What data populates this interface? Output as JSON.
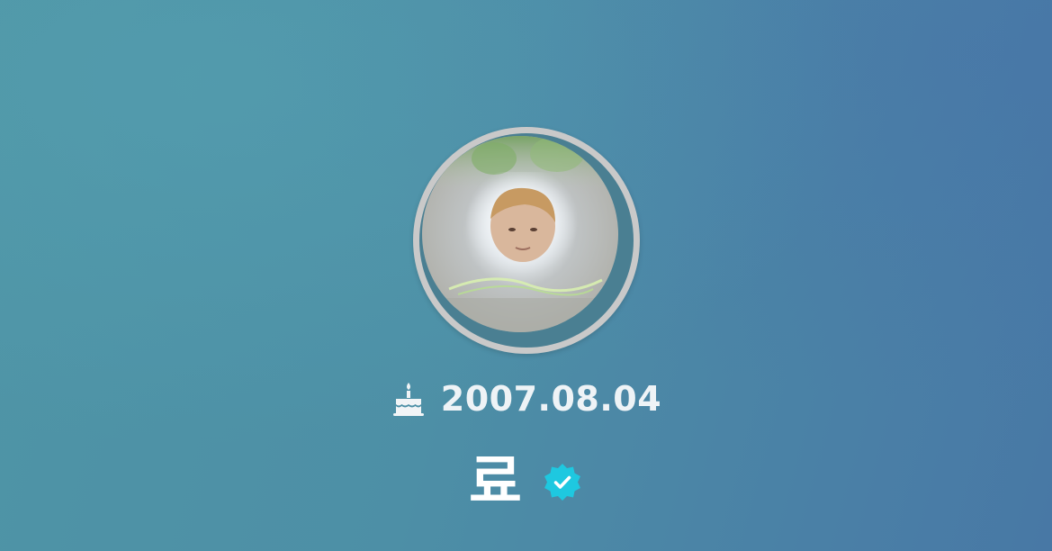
{
  "profile": {
    "birthday": "2007.08.04",
    "name": "료",
    "verified": true
  },
  "icons": {
    "birthday": "cake-icon",
    "verified": "verified-badge-icon"
  },
  "colors": {
    "background": "#4d8fa6",
    "avatar_ring": "#c9c9c9",
    "verified_badge": "#1ec8e0",
    "text": "#ffffff"
  }
}
